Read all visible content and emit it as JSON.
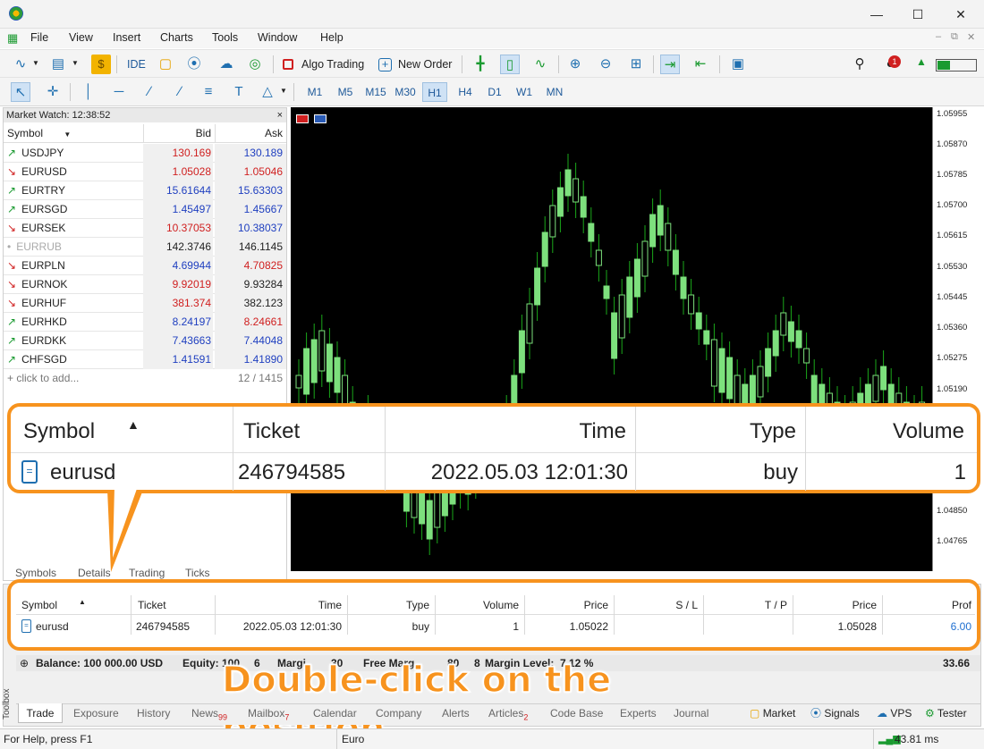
{
  "menu": [
    "File",
    "View",
    "Insert",
    "Charts",
    "Tools",
    "Window",
    "Help"
  ],
  "toolbar": {
    "ide": "IDE",
    "algo_trading": "Algo Trading",
    "new_order": "New Order",
    "notification_count": "1"
  },
  "timeframes": [
    "M1",
    "M5",
    "M15",
    "M30",
    "H1",
    "H4",
    "D1",
    "W1",
    "MN"
  ],
  "market_watch": {
    "title": "Market Watch: 12:38:52",
    "close": "×",
    "headers": {
      "symbol": "Symbol",
      "bid": "Bid",
      "ask": "Ask"
    },
    "rows": [
      {
        "dir": "↗",
        "symbol": "USDJPY",
        "bid": "130.169",
        "ask": "130.189",
        "bid_color": "#d02020",
        "ask_color": "#2040c0"
      },
      {
        "dir": "↘",
        "symbol": "EURUSD",
        "bid": "1.05028",
        "ask": "1.05046",
        "bid_color": "#d02020",
        "ask_color": "#d02020"
      },
      {
        "dir": "↗",
        "symbol": "EURTRY",
        "bid": "15.61644",
        "ask": "15.63303",
        "bid_color": "#2040c0",
        "ask_color": "#2040c0"
      },
      {
        "dir": "↗",
        "symbol": "EURSGD",
        "bid": "1.45497",
        "ask": "1.45667",
        "bid_color": "#2040c0",
        "ask_color": "#2040c0"
      },
      {
        "dir": "↘",
        "symbol": "EURSEK",
        "bid": "10.37053",
        "ask": "10.38037",
        "bid_color": "#d02020",
        "ask_color": "#2040c0"
      },
      {
        "dir": "•",
        "symbol": "EURRUB",
        "bid": "142.3746",
        "ask": "146.1145",
        "bid_color": "#222222",
        "ask_color": "#222222"
      },
      {
        "dir": "↘",
        "symbol": "EURPLN",
        "bid": "4.69944",
        "ask": "4.70825",
        "bid_color": "#2040c0",
        "ask_color": "#d02020"
      },
      {
        "dir": "↘",
        "symbol": "EURNOK",
        "bid": "9.92019",
        "ask": "9.93284",
        "bid_color": "#d02020",
        "ask_color": "#222222"
      },
      {
        "dir": "↘",
        "symbol": "EURHUF",
        "bid": "381.374",
        "ask": "382.123",
        "bid_color": "#d02020",
        "ask_color": "#222222"
      },
      {
        "dir": "↗",
        "symbol": "EURHKD",
        "bid": "8.24197",
        "ask": "8.24661",
        "bid_color": "#2040c0",
        "ask_color": "#d02020"
      },
      {
        "dir": "↗",
        "symbol": "EURDKK",
        "bid": "7.43663",
        "ask": "7.44048",
        "bid_color": "#2040c0",
        "ask_color": "#2040c0"
      },
      {
        "dir": "↗",
        "symbol": "CHFSGD",
        "bid": "1.41591",
        "ask": "1.41890",
        "bid_color": "#2040c0",
        "ask_color": "#2040c0"
      }
    ],
    "add": "+ click to add...",
    "count": "12 / 1415",
    "tabs": [
      "Symbols",
      "Details",
      "Trading",
      "Ticks"
    ]
  },
  "price_axis": [
    "1.05955",
    "1.05870",
    "1.05785",
    "1.05700",
    "1.05615",
    "1.05530",
    "1.05445",
    "1.05360",
    "1.05275",
    "1.05190",
    "1.04850",
    "1.04765"
  ],
  "zoom_callout": {
    "headers": {
      "symbol": "Symbol",
      "ticket": "Ticket",
      "time": "Time",
      "type": "Type",
      "volume": "Volume"
    },
    "row": {
      "symbol": "eurusd",
      "ticket": "246794585",
      "time": "2022.05.03 12:01:30",
      "type": "buy",
      "volume": "1"
    }
  },
  "trade": {
    "headers": {
      "symbol": "Symbol",
      "ticket": "Ticket",
      "time": "Time",
      "type": "Type",
      "volume": "Volume",
      "price": "Price",
      "sl": "S / L",
      "tp": "T / P",
      "price2": "Price",
      "profit": "Prof"
    },
    "row": {
      "symbol": "eurusd",
      "ticket": "246794585",
      "time": "2022.05.03 12:01:30",
      "type": "buy",
      "volume": "1",
      "price": "1.05022",
      "sl": "",
      "tp": "",
      "price2": "1.05028",
      "profit": "6.00"
    }
  },
  "balance_line": {
    "balance": "Balance: 100 000.00 USD",
    "equity": "Equity: 100",
    "frag1": "6",
    "margin": "Margi",
    "frag2": "30",
    "free_margin": "Free Marg",
    "frag3": "80",
    "frag4": "8",
    "margin_level": "Margin Level:",
    "frag5": "7 12 %",
    "total": "33.66"
  },
  "instruction": "Double-click on the position",
  "toolbox_label": "Toolbox",
  "bottom_tabs": [
    {
      "label": "Trade",
      "badge": ""
    },
    {
      "label": "Exposure",
      "badge": ""
    },
    {
      "label": "History",
      "badge": ""
    },
    {
      "label": "News",
      "badge": "99"
    },
    {
      "label": "Mailbox",
      "badge": "7"
    },
    {
      "label": "Calendar",
      "badge": ""
    },
    {
      "label": "Company",
      "badge": ""
    },
    {
      "label": "Alerts",
      "badge": ""
    },
    {
      "label": "Articles",
      "badge": "2"
    },
    {
      "label": "Code Base",
      "badge": ""
    },
    {
      "label": "Experts",
      "badge": ""
    },
    {
      "label": "Journal",
      "badge": ""
    }
  ],
  "right_tabs": [
    "Market",
    "Signals",
    "VPS",
    "Tester"
  ],
  "status": {
    "help": "For Help, press F1",
    "profile": "Euro",
    "ping": "43.81 ms"
  },
  "colors": {
    "accent": "#f7931e",
    "bull": "#7de07d",
    "wick": "#1aa81a",
    "link": "#1f6fd0"
  }
}
